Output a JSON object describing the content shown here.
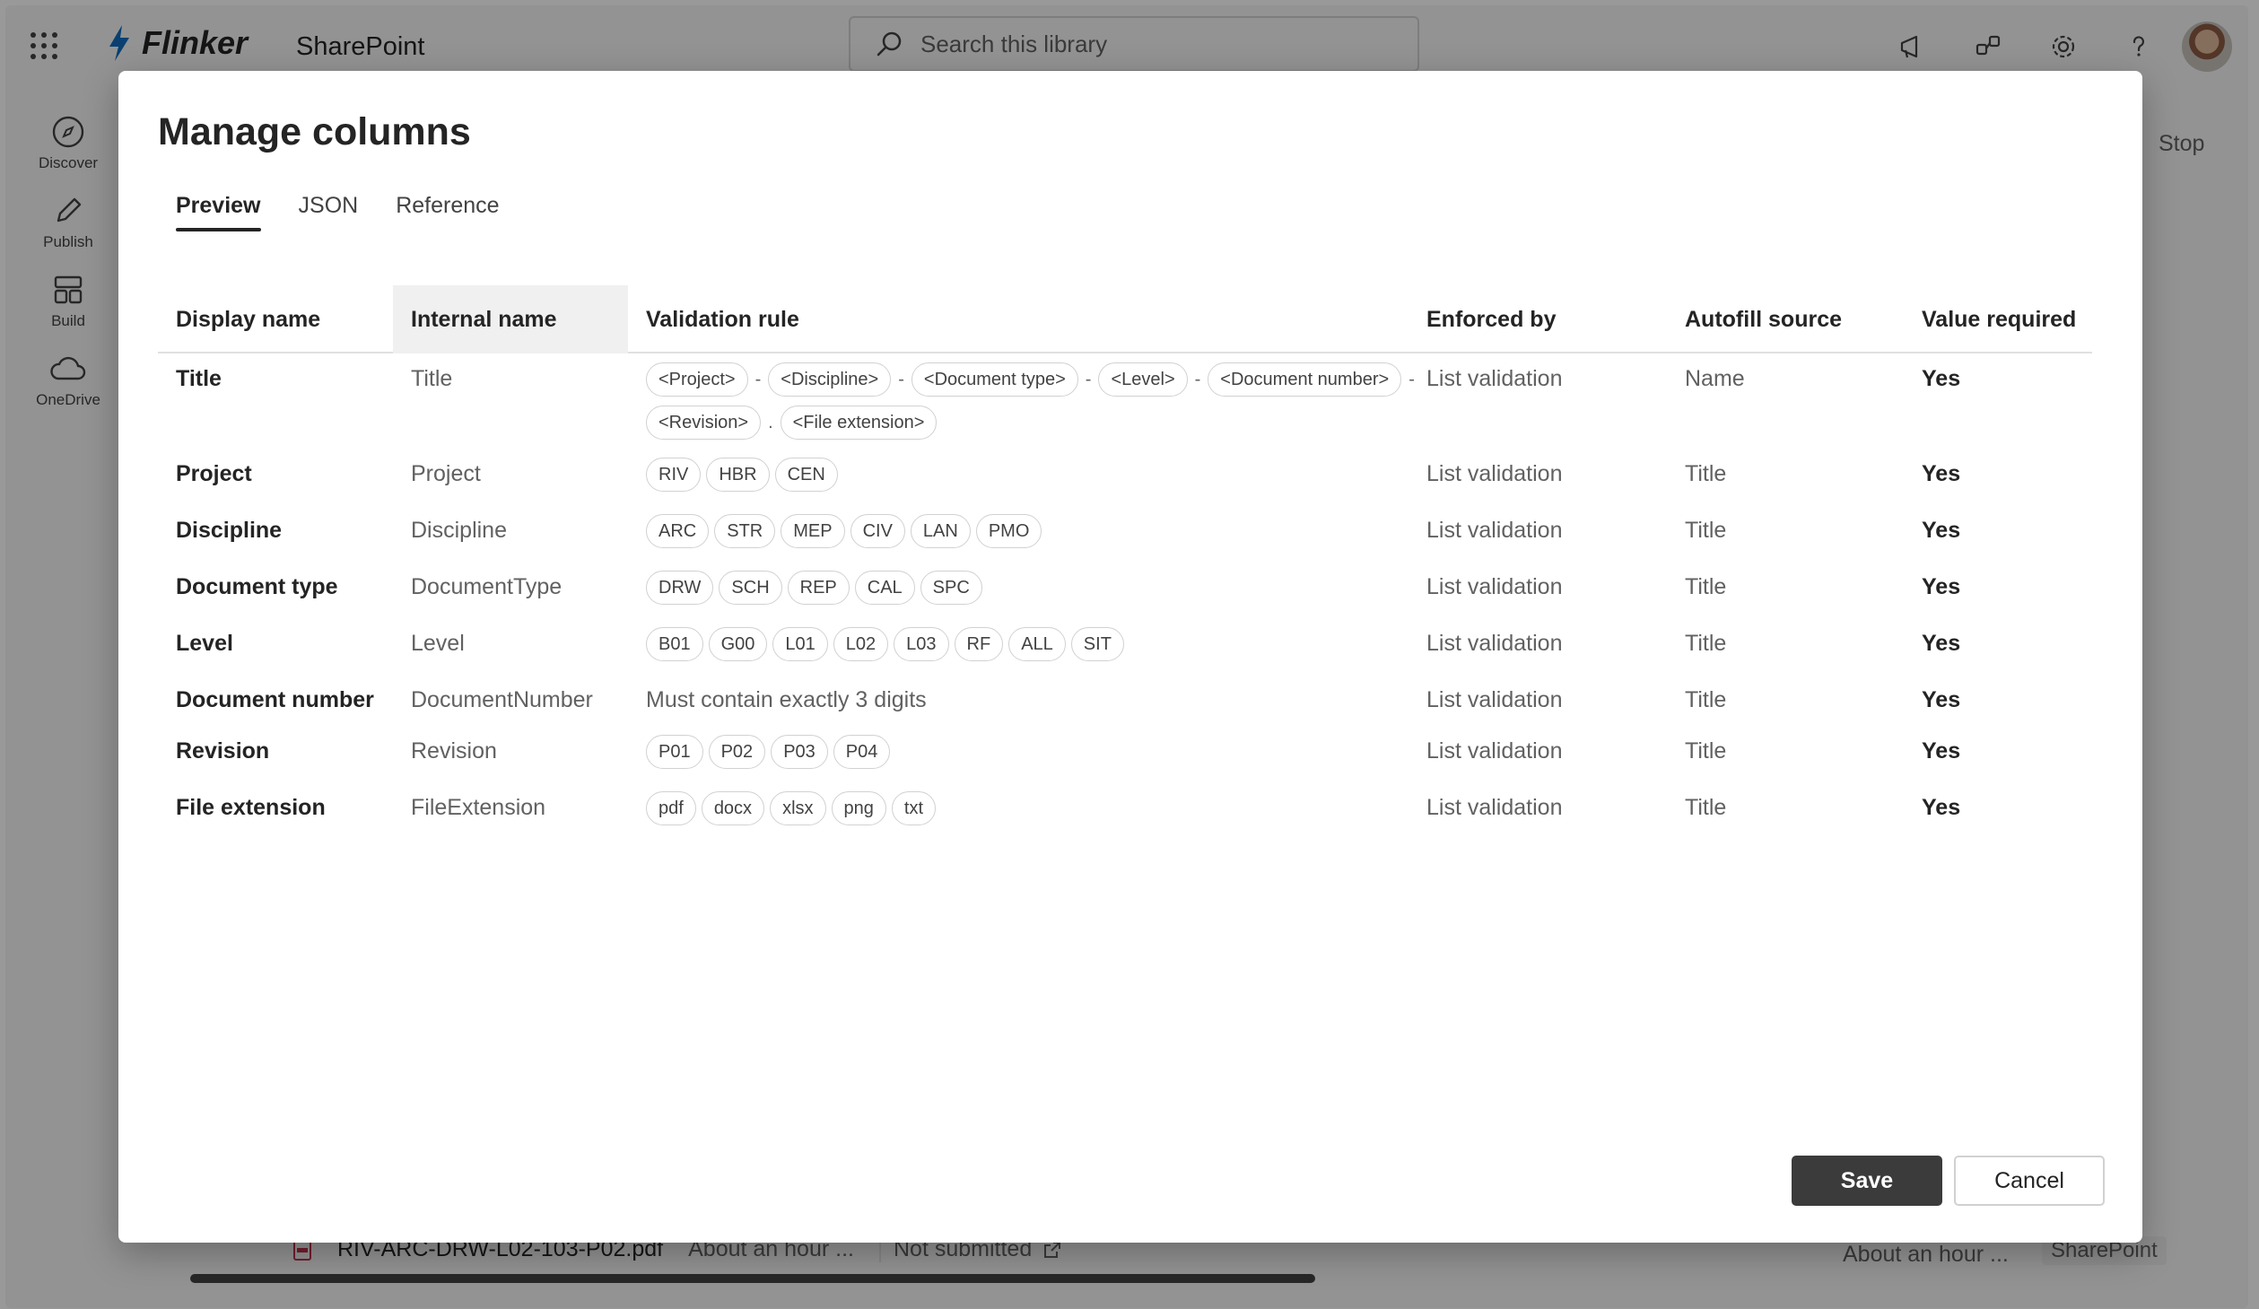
{
  "app": {
    "brand_name": "Flinker",
    "app_name": "SharePoint",
    "search_placeholder": "Search this library"
  },
  "left_rail": [
    {
      "label": "Discover",
      "icon": "compass-icon"
    },
    {
      "label": "Publish",
      "icon": "pen-icon"
    },
    {
      "label": "Build",
      "icon": "layout-icon"
    },
    {
      "label": "OneDrive",
      "icon": "cloud-icon"
    }
  ],
  "background": {
    "file_name": "RIV-ARC-DRW-L02-103-P02.pdf",
    "modified": "About an hour ...",
    "status": "Not submitted",
    "modified_right": "About an hour ...",
    "source": "SharePoint",
    "side_button": "Stop"
  },
  "dialog": {
    "title": "Manage columns",
    "tabs": [
      {
        "label": "Preview",
        "active": true
      },
      {
        "label": "JSON",
        "active": false
      },
      {
        "label": "Reference",
        "active": false
      }
    ],
    "headers": {
      "display_name": "Display name",
      "internal_name": "Internal name",
      "validation_rule": "Validation rule",
      "enforced_by": "Enforced by",
      "autofill_source": "Autofill source",
      "value_required": "Value required"
    },
    "rows": [
      {
        "display_name": "Title",
        "internal_name": "Title",
        "rule_tokens": [
          "<Project>",
          "-",
          "<Discipline>",
          "-",
          "<Document type>",
          "-",
          "<Level>",
          "-",
          "<Document number>",
          "-",
          "<Revision>",
          ".",
          "<File extension>"
        ],
        "enforced_by": "List validation",
        "autofill_source": "Name",
        "value_required": "Yes"
      },
      {
        "display_name": "Project",
        "internal_name": "Project",
        "rule_chips": [
          "RIV",
          "HBR",
          "CEN"
        ],
        "enforced_by": "List validation",
        "autofill_source": "Title",
        "value_required": "Yes"
      },
      {
        "display_name": "Discipline",
        "internal_name": "Discipline",
        "rule_chips": [
          "ARC",
          "STR",
          "MEP",
          "CIV",
          "LAN",
          "PMO"
        ],
        "enforced_by": "List validation",
        "autofill_source": "Title",
        "value_required": "Yes"
      },
      {
        "display_name": "Document type",
        "internal_name": "DocumentType",
        "rule_chips": [
          "DRW",
          "SCH",
          "REP",
          "CAL",
          "SPC"
        ],
        "enforced_by": "List validation",
        "autofill_source": "Title",
        "value_required": "Yes"
      },
      {
        "display_name": "Level",
        "internal_name": "Level",
        "rule_chips": [
          "B01",
          "G00",
          "L01",
          "L02",
          "L03",
          "RF",
          "ALL",
          "SIT"
        ],
        "enforced_by": "List validation",
        "autofill_source": "Title",
        "value_required": "Yes"
      },
      {
        "display_name": "Document number",
        "internal_name": "DocumentNumber",
        "rule_text": "Must contain exactly 3 digits",
        "enforced_by": "List validation",
        "autofill_source": "Title",
        "value_required": "Yes"
      },
      {
        "display_name": "Revision",
        "internal_name": "Revision",
        "rule_chips": [
          "P01",
          "P02",
          "P03",
          "P04"
        ],
        "enforced_by": "List validation",
        "autofill_source": "Title",
        "value_required": "Yes"
      },
      {
        "display_name": "File extension",
        "internal_name": "FileExtension",
        "rule_chips": [
          "pdf",
          "docx",
          "xlsx",
          "png",
          "txt"
        ],
        "enforced_by": "List validation",
        "autofill_source": "Title",
        "value_required": "Yes"
      }
    ],
    "save_label": "Save",
    "cancel_label": "Cancel"
  },
  "colors": {
    "primary_button": "#3b3b3b",
    "brand_accent": "#0f6cbd",
    "overlay": "rgba(0,0,0,0.40)"
  }
}
